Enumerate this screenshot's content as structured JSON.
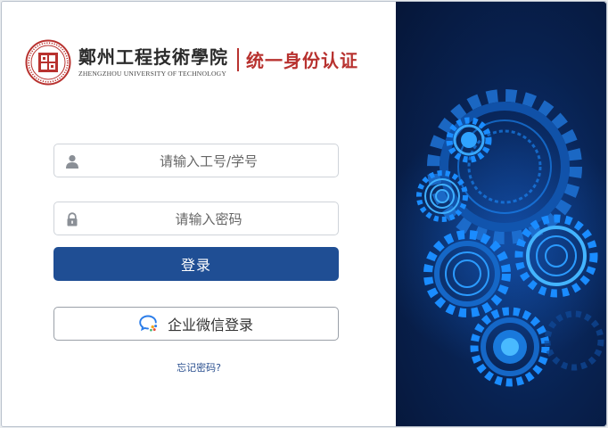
{
  "branding": {
    "school_name_cn": "鄭州工程技術學院",
    "school_name_en": "ZHENGZHOU UNIVERSITY OF TECHNOLOGY",
    "portal_title": "统一身份认证"
  },
  "login_form": {
    "username_placeholder": "请输入工号/学号",
    "username_value": "",
    "password_placeholder": "请输入密码",
    "password_value": "",
    "login_label": "登录",
    "wechat_label": "企业微信登录",
    "forgot_label": "忘记密码?"
  },
  "icons": {
    "username": "user-icon",
    "password": "lock-icon",
    "wechat": "wechat-work-icon",
    "seal": "university-seal-icon"
  },
  "colors": {
    "brand_red": "#b8322f",
    "primary_blue": "#1f4e94",
    "panel_dark": "#08214f",
    "gear_blue": "#1a8cff"
  }
}
